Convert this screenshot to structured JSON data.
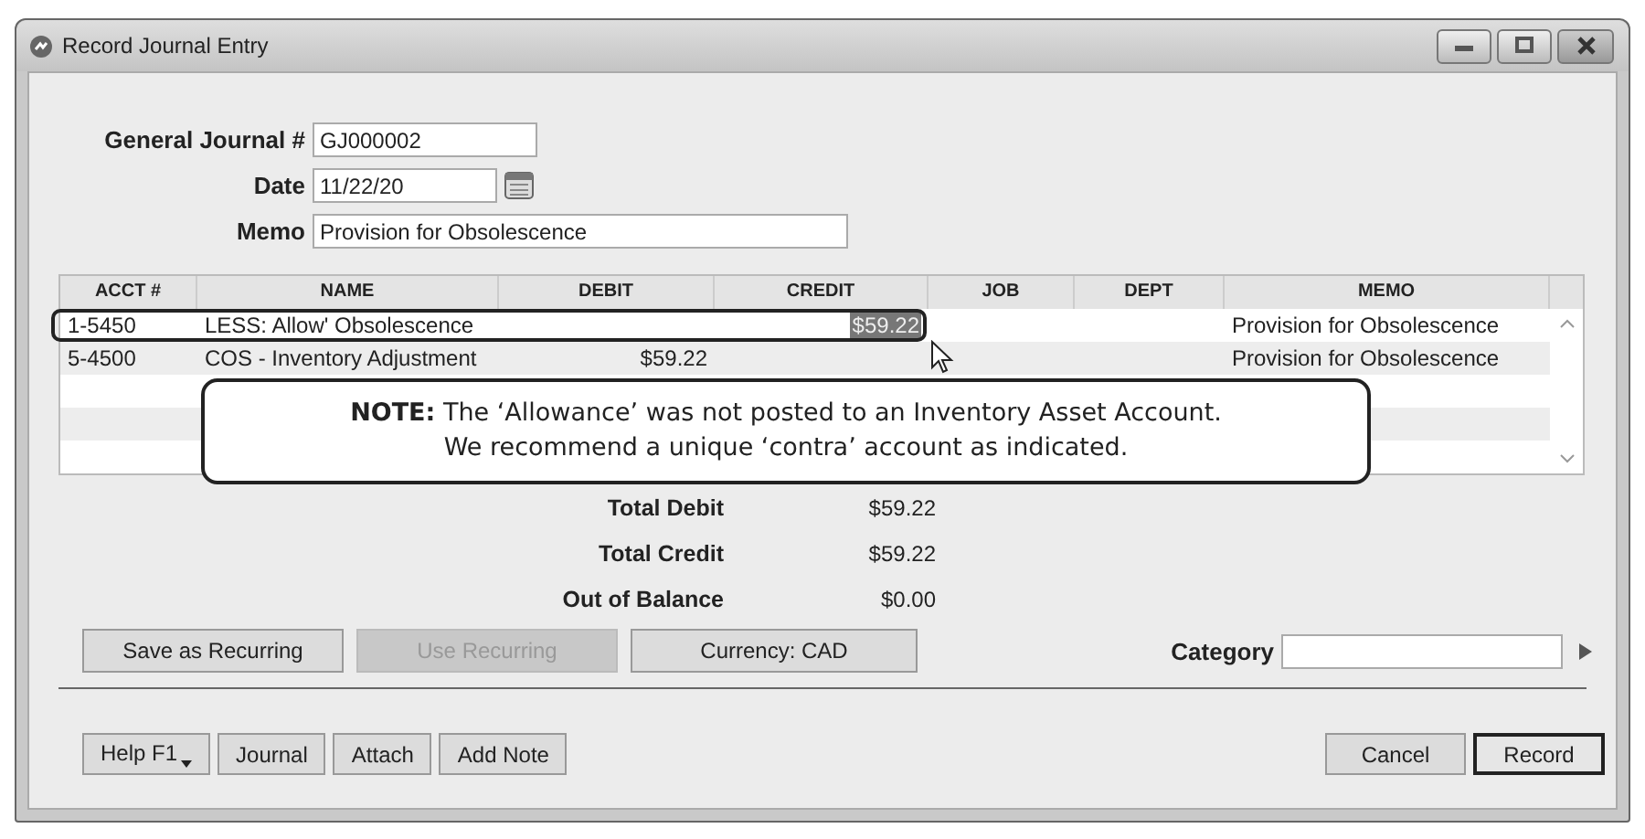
{
  "window": {
    "title": "Record Journal Entry"
  },
  "header_fields": [
    {
      "label": "General Journal #",
      "value": "GJ000002",
      "kind": "text"
    },
    {
      "label": "Date",
      "value": "11/22/20",
      "kind": "date"
    },
    {
      "label": "Memo",
      "value": "Provision for Obsolescence",
      "kind": "wide"
    }
  ],
  "table": {
    "columns": [
      "ACCT #",
      "NAME",
      "DEBIT",
      "CREDIT",
      "JOB",
      "DEPT",
      "MEMO"
    ],
    "rows": [
      {
        "acct": "1-5450",
        "name": "LESS: Allow'  Obsolescence",
        "credit": "$59.22",
        "memo": "Provision for Obsolescence",
        "credit_selected": true,
        "outlined": true
      },
      {
        "acct": "5-4500",
        "name": "COS - Inventory Adjustment",
        "debit": "$59.22",
        "memo": "Provision for Obsolescence",
        "credit_selected": false,
        "outlined": false
      }
    ]
  },
  "note": {
    "lines": [
      "**NOTE:** The ‘Allowance’ was not posted to an Inventory Asset Account.",
      "We recommend a unique ‘contra’ account as indicated."
    ]
  },
  "totals": [
    {
      "label": "Total Debit",
      "value": "$59.22"
    },
    {
      "label": "Total Credit",
      "value": "$59.22"
    },
    {
      "label": "Out of Balance",
      "value": "$0.00"
    }
  ],
  "action_buttons": [
    {
      "label": "Save as Recurring",
      "disabled": false
    },
    {
      "label": "Use Recurring",
      "disabled": true
    },
    {
      "label": "Currency: CAD",
      "disabled": false
    }
  ],
  "category": {
    "label": "Category"
  },
  "footer_left_buttons": [
    {
      "label": "Help F1",
      "kind": "dropdown"
    },
    {
      "label": "Journal",
      "kind": "plain"
    },
    {
      "label": "Attach",
      "kind": "plain"
    },
    {
      "label": "Add Note",
      "kind": "plain"
    }
  ],
  "footer_right_buttons": [
    {
      "label": "Cancel",
      "default": false
    },
    {
      "label": "Record",
      "default": true
    }
  ]
}
